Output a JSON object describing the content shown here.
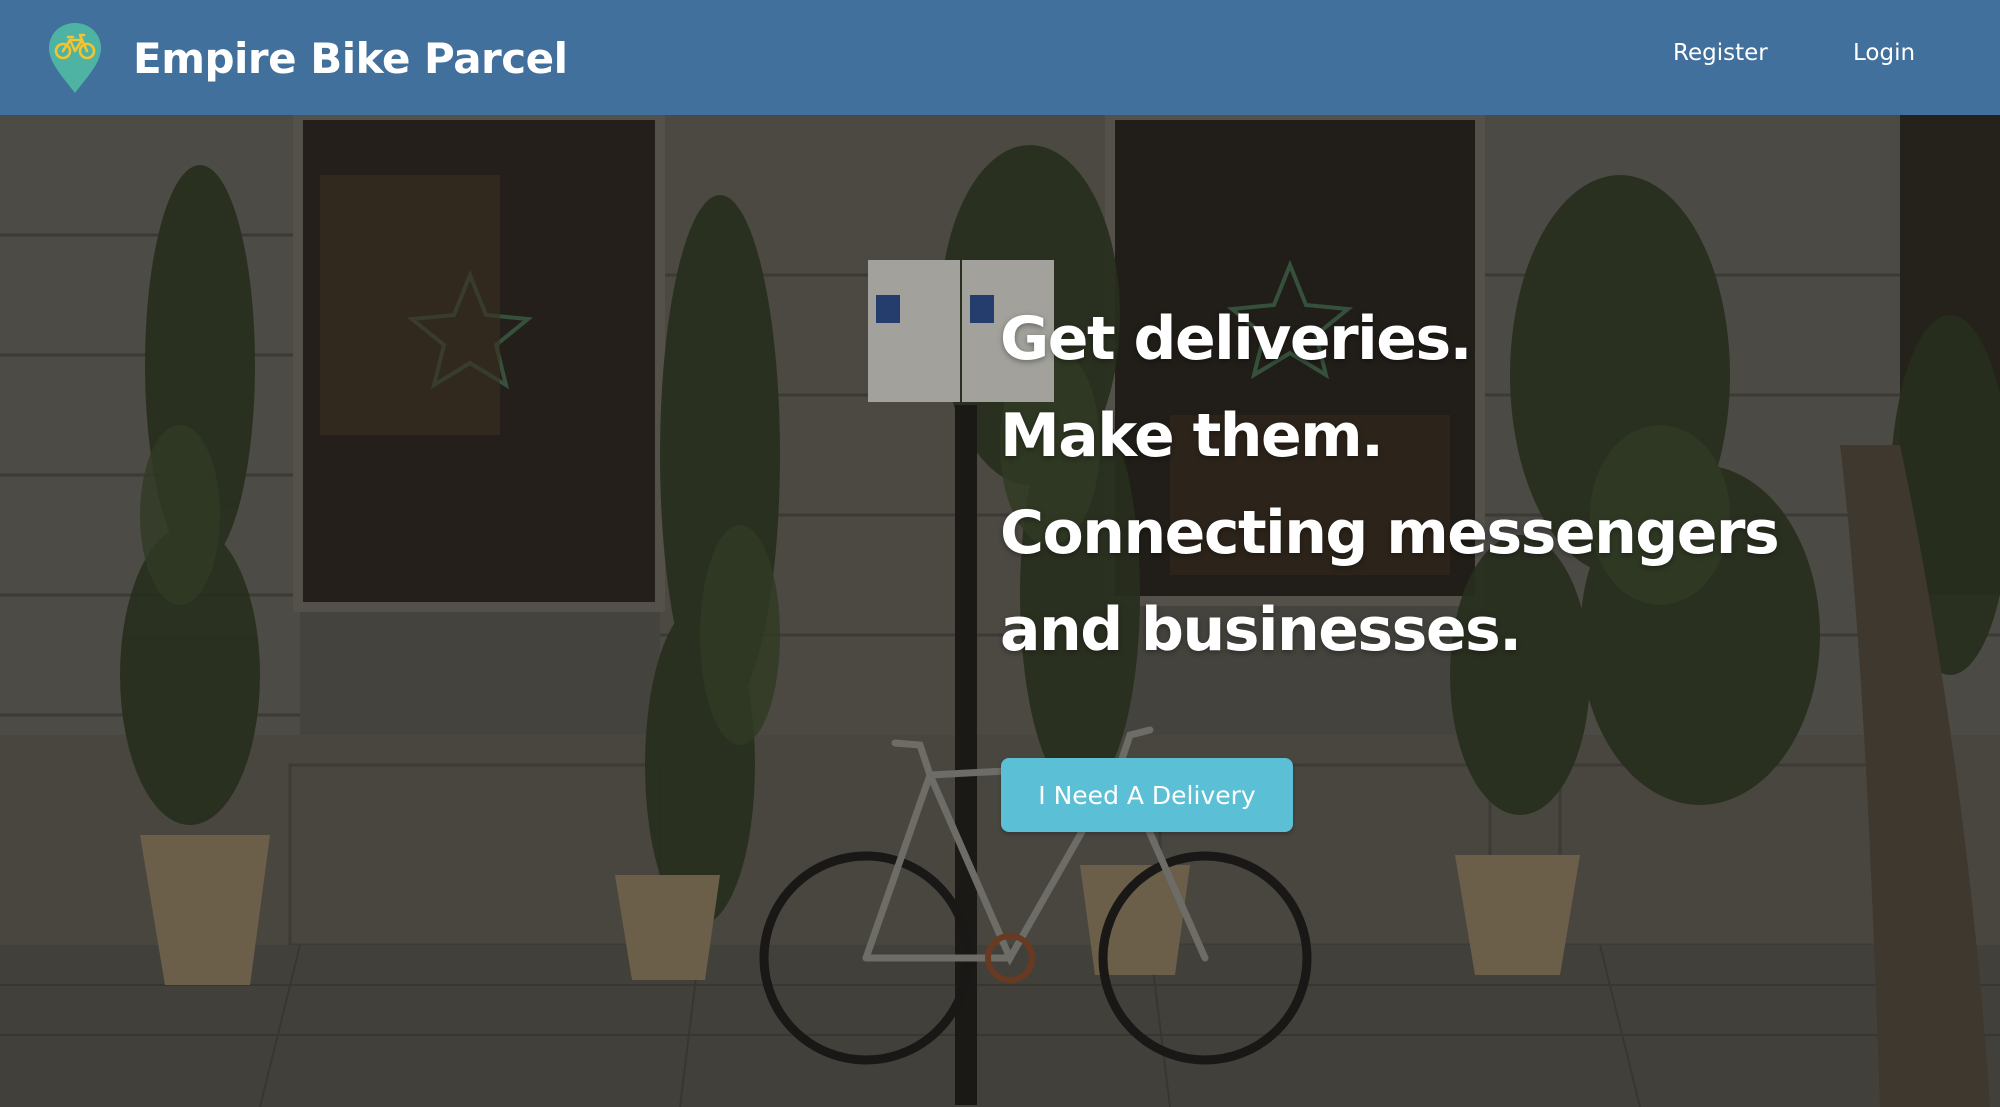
{
  "colors": {
    "navbar": "#41709c",
    "accent": "#5bbfd6",
    "logo_pin": "#4fb3a4",
    "logo_bike": "#f2c431",
    "text": "#ffffff"
  },
  "navbar": {
    "brand_name": "Empire Bike Parcel",
    "logo_icon": "bike-location-pin-icon",
    "links": {
      "register": "Register",
      "login": "Login"
    }
  },
  "hero": {
    "headline": [
      "Get deliveries.",
      "Make them.",
      "Connecting messengers",
      "and businesses."
    ],
    "cta_label": "I Need A Delivery"
  }
}
